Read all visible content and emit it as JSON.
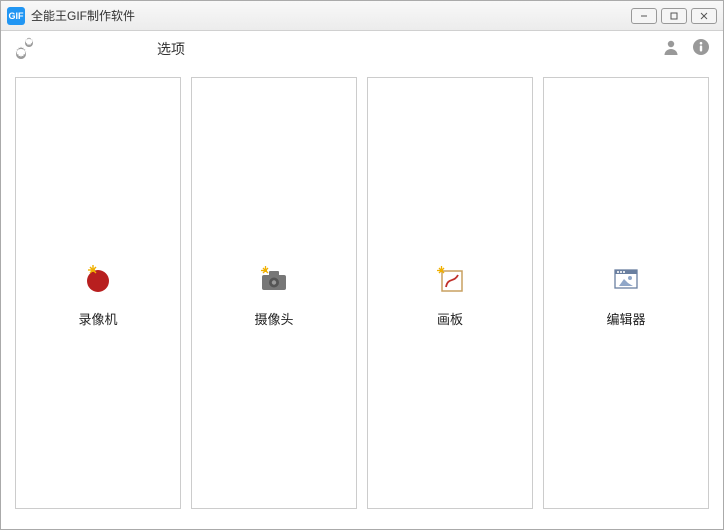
{
  "titlebar": {
    "icon_text": "GIF",
    "title": "全能王GIF制作软件"
  },
  "toolbar": {
    "options_label": "选项"
  },
  "cards": {
    "recorder": "录像机",
    "camera": "摄像头",
    "canvas": "画板",
    "editor": "编辑器"
  }
}
